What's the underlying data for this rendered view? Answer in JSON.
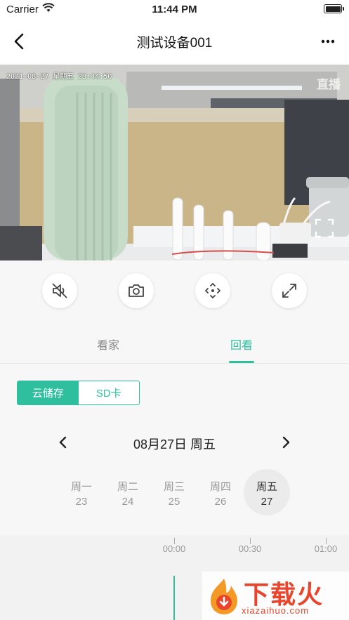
{
  "status_bar": {
    "carrier": "Carrier",
    "time": "11:44 PM"
  },
  "nav": {
    "title": "测试设备001"
  },
  "video": {
    "timestamp": "2021-08-27 星期五 23:44:50",
    "live_label": "直播"
  },
  "controls": [
    "mute-icon",
    "camera-icon",
    "ptz-direction-icon",
    "fullscreen-icon"
  ],
  "tabs": {
    "live": "看家",
    "playback": "回看"
  },
  "storage": {
    "cloud": "云储存",
    "sd": "SD卡"
  },
  "date": {
    "label": "08月27日 周五"
  },
  "days": [
    {
      "weekday": "周一",
      "day": "23"
    },
    {
      "weekday": "周二",
      "day": "24"
    },
    {
      "weekday": "周三",
      "day": "25"
    },
    {
      "weekday": "周四",
      "day": "26"
    },
    {
      "weekday": "周五",
      "day": "27",
      "selected": true
    }
  ],
  "timeline": {
    "labels": [
      "00:00",
      "00:30",
      "01:00"
    ]
  },
  "watermark": {
    "text": "下载火",
    "sub": "xiazaihuo.com"
  },
  "colors": {
    "accent": "#2fbf9f",
    "watermark": "#e8452c"
  }
}
